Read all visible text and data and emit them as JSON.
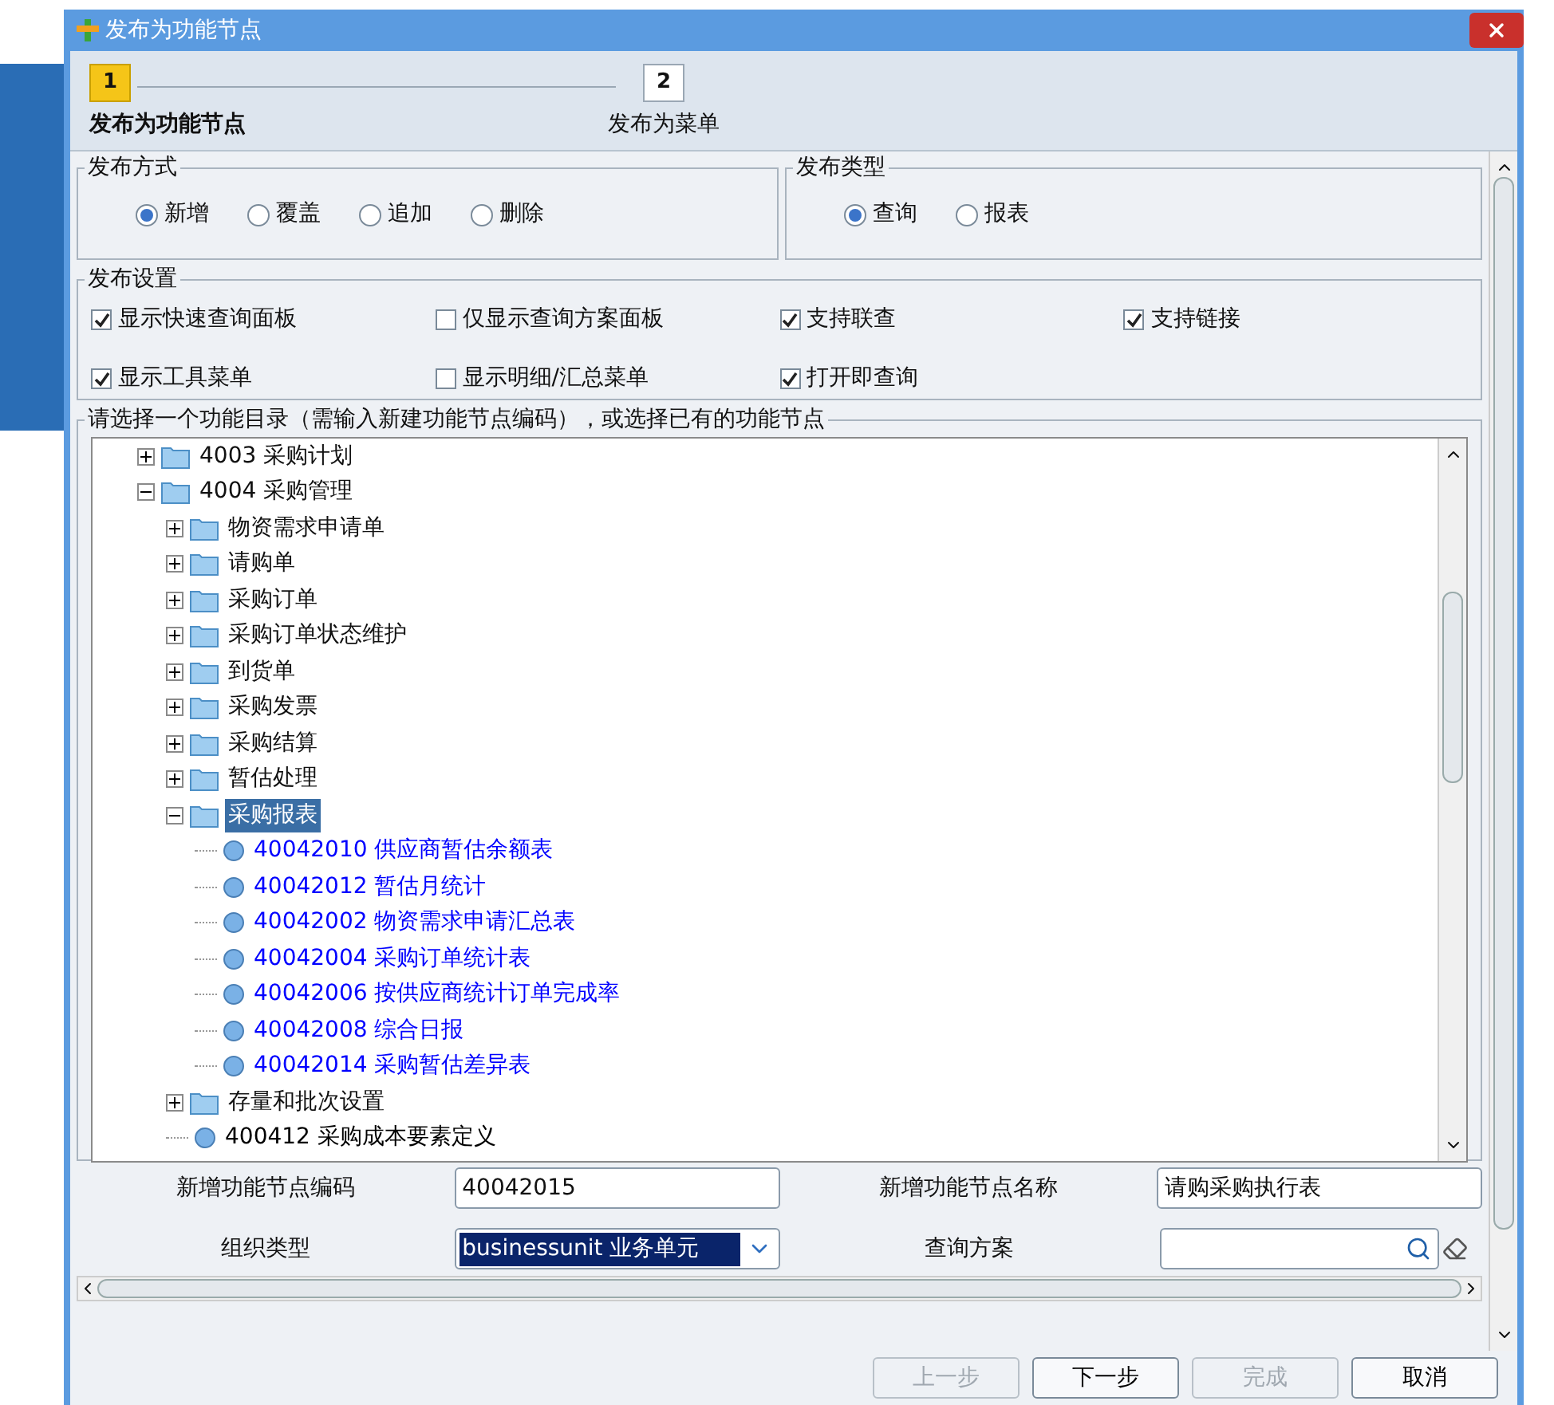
{
  "window": {
    "title": "发布为功能节点"
  },
  "steps": [
    {
      "number": "1",
      "label": "发布为功能节点",
      "selected": true
    },
    {
      "number": "2",
      "label": "发布为菜单",
      "selected": false
    }
  ],
  "publish_mode": {
    "legend": "发布方式",
    "options": [
      {
        "label": "新增",
        "selected": true
      },
      {
        "label": "覆盖",
        "selected": false
      },
      {
        "label": "追加",
        "selected": false
      },
      {
        "label": "删除",
        "selected": false
      }
    ]
  },
  "publish_type": {
    "legend": "发布类型",
    "options": [
      {
        "label": "查询",
        "selected": true
      },
      {
        "label": "报表",
        "selected": false
      }
    ]
  },
  "settings": {
    "legend": "发布设置",
    "options": [
      {
        "label": "显示快速查询面板",
        "checked": true
      },
      {
        "label": "仅显示查询方案面板",
        "checked": false
      },
      {
        "label": "支持联查",
        "checked": true
      },
      {
        "label": "支持链接",
        "checked": true
      },
      {
        "label": "显示工具菜单",
        "checked": true
      },
      {
        "label": "显示明细/汇总菜单",
        "checked": false
      },
      {
        "label": "打开即查询",
        "checked": true
      }
    ]
  },
  "tree": {
    "legend": "请选择一个功能目录（需输入新建功能节点编码），或选择已有的功能节点",
    "items": [
      {
        "kind": "folder",
        "label": "4003 采购计划",
        "expanded": false,
        "selected": false
      },
      {
        "kind": "folder",
        "label": "4004 采购管理",
        "expanded": true,
        "selected": false,
        "children": [
          {
            "kind": "folder",
            "label": "物资需求申请单",
            "expanded": false,
            "selected": false
          },
          {
            "kind": "folder",
            "label": "请购单",
            "expanded": false,
            "selected": false
          },
          {
            "kind": "folder",
            "label": "采购订单",
            "expanded": false,
            "selected": false
          },
          {
            "kind": "folder",
            "label": "采购订单状态维护",
            "expanded": false,
            "selected": false
          },
          {
            "kind": "folder",
            "label": "到货单",
            "expanded": false,
            "selected": false
          },
          {
            "kind": "folder",
            "label": "采购发票",
            "expanded": false,
            "selected": false
          },
          {
            "kind": "folder",
            "label": "采购结算",
            "expanded": false,
            "selected": false
          },
          {
            "kind": "folder",
            "label": "暂估处理",
            "expanded": false,
            "selected": false
          },
          {
            "kind": "folder",
            "label": "采购报表",
            "expanded": true,
            "selected": true,
            "children": [
              {
                "kind": "node",
                "label": "40042010 供应商暂估余额表",
                "selected": false,
                "color": "#0000ff"
              },
              {
                "kind": "node",
                "label": "40042012 暂估月统计",
                "selected": false,
                "color": "#0000ff"
              },
              {
                "kind": "node",
                "label": "40042002 物资需求申请汇总表",
                "selected": false,
                "color": "#0000ff"
              },
              {
                "kind": "node",
                "label": "40042004 采购订单统计表",
                "selected": false,
                "color": "#0000ff"
              },
              {
                "kind": "node",
                "label": "40042006 按供应商统计订单完成率",
                "selected": false,
                "color": "#0000ff"
              },
              {
                "kind": "node",
                "label": "40042008 综合日报",
                "selected": false,
                "color": "#0000ff"
              },
              {
                "kind": "node",
                "label": "40042014 采购暂估差异表",
                "selected": false,
                "color": "#0000ff"
              }
            ]
          },
          {
            "kind": "folder",
            "label": "存量和批次设置",
            "expanded": false,
            "selected": false
          },
          {
            "kind": "node",
            "label": "400412 采购成本要素定义",
            "selected": false,
            "color": "#000000"
          }
        ]
      }
    ]
  },
  "form": [
    {
      "kind": "text",
      "label": "新增功能节点编码",
      "value": "40042015"
    },
    {
      "kind": "text",
      "label": "新增功能节点名称",
      "value": "请购采购执行表"
    },
    {
      "kind": "select",
      "label": "组织类型",
      "value": "businessunit 业务单元"
    },
    {
      "kind": "search",
      "label": "查询方案"
    }
  ],
  "buttons": [
    {
      "label": "上一步",
      "disabled": true
    },
    {
      "label": "下一步",
      "disabled": false
    },
    {
      "label": "完成",
      "disabled": true
    },
    {
      "label": "取消",
      "disabled": false
    }
  ]
}
